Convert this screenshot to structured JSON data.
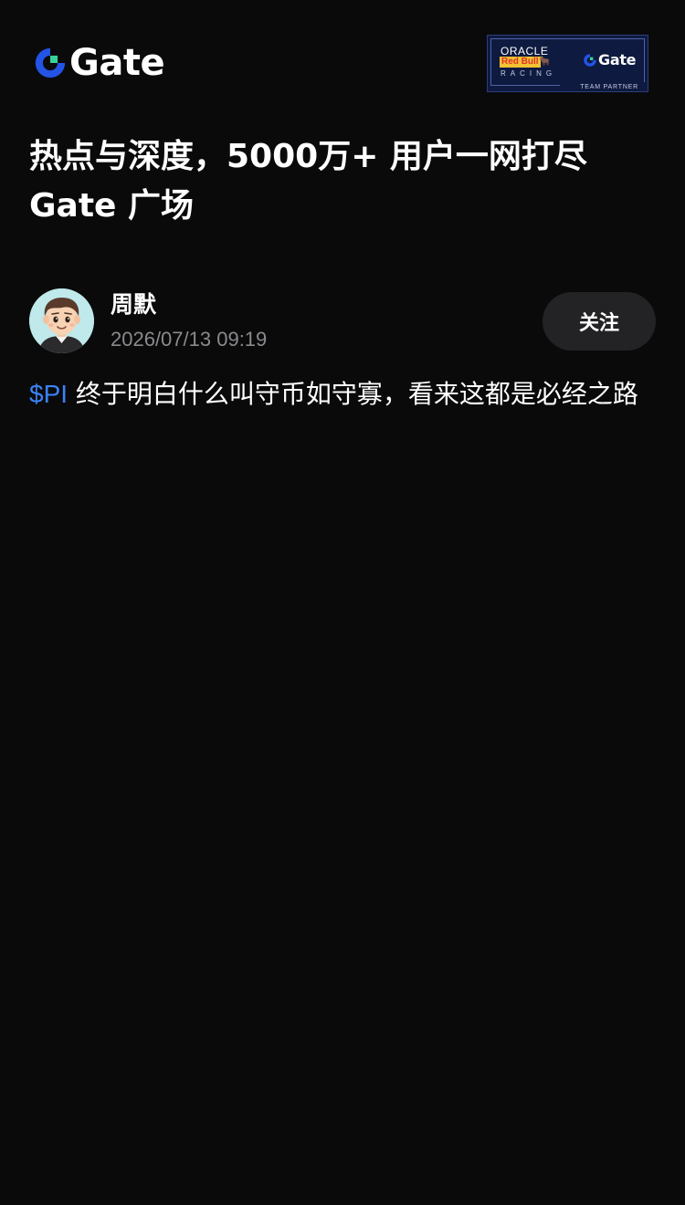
{
  "header": {
    "brand_name": "Gate",
    "brand_color": "#2354e6",
    "brand_accent": "#35d29a",
    "partner_badge": {
      "oracle": "ORACLE",
      "redbull": "Red Bull",
      "racing": "RACING",
      "gate": "Gate",
      "team_partner": "TEAM PARTNER"
    }
  },
  "headline": {
    "line1": "热点与深度，5000万+ 用户一网打尽",
    "line2": "Gate 广场"
  },
  "post": {
    "author": {
      "name": "周默",
      "avatar_icon": "cartoon-boy-avatar"
    },
    "timestamp": "2026/07/13 09:19",
    "follow_label": "关注",
    "ticker": "$PI",
    "text": " 终于明白什么叫守币如守寡，看来这都是必经之路",
    "ticker_color": "#3b82f6"
  }
}
